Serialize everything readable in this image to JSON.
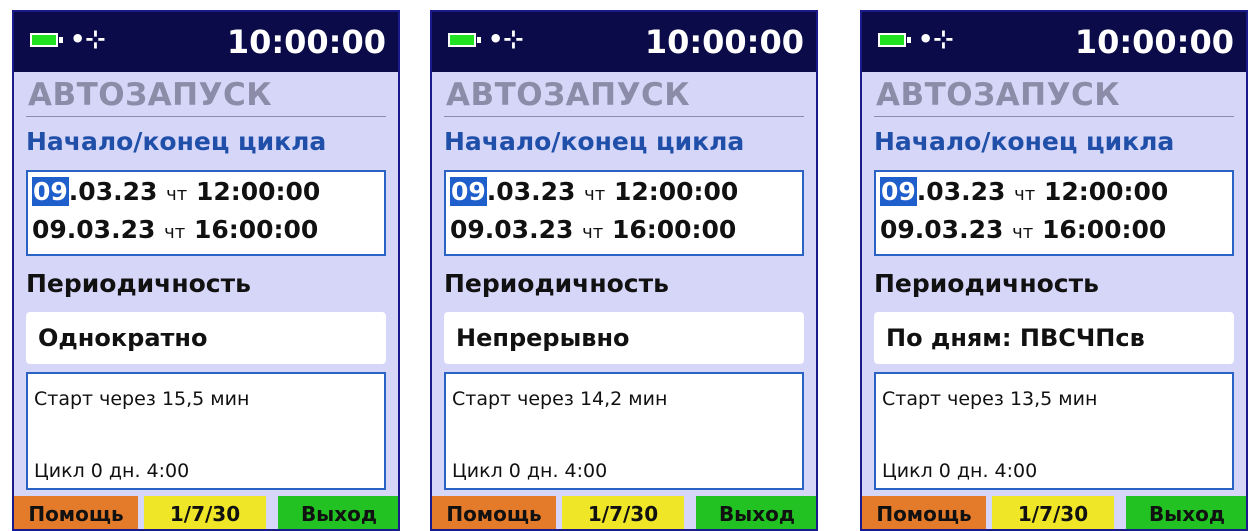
{
  "screens": [
    {
      "time": "10:00:00",
      "usb_glyph": "•⊹",
      "title": "АВТОЗАПУСК",
      "cycle_label": "Начало/конец цикла",
      "start": {
        "day": "09",
        "rest": ".03.23",
        "dow": "чт",
        "time": "12:00:00"
      },
      "end": {
        "date": "09.03.23",
        "dow": "чт",
        "time": "16:00:00"
      },
      "period_label": "Периодичность",
      "period_value": "Однократно",
      "start_in": "Старт через 15,5 мин",
      "cycle_len": "Цикл 0 дн. 4:00",
      "buttons": {
        "help": "Помощь",
        "mid": "1/7/30",
        "exit": "Выход"
      }
    },
    {
      "time": "10:00:00",
      "usb_glyph": "•⊹",
      "title": "АВТОЗАПУСК",
      "cycle_label": "Начало/конец цикла",
      "start": {
        "day": "09",
        "rest": ".03.23",
        "dow": "чт",
        "time": "12:00:00"
      },
      "end": {
        "date": "09.03.23",
        "dow": "чт",
        "time": "16:00:00"
      },
      "period_label": "Периодичность",
      "period_value": "Непрерывно",
      "start_in": "Старт через 14,2 мин",
      "cycle_len": "Цикл 0 дн. 4:00",
      "buttons": {
        "help": "Помощь",
        "mid": "1/7/30",
        "exit": "Выход"
      }
    },
    {
      "time": "10:00:00",
      "usb_glyph": "•⊹",
      "title": "АВТОЗАПУСК",
      "cycle_label": "Начало/конец цикла",
      "start": {
        "day": "09",
        "rest": ".03.23",
        "dow": "чт",
        "time": "12:00:00"
      },
      "end": {
        "date": "09.03.23",
        "dow": "чт",
        "time": "16:00:00"
      },
      "period_label": "Периодичность",
      "period_value": "По дням:  ПВСЧПсв",
      "start_in": "Старт через 13,5 мин",
      "cycle_len": "Цикл 0 дн. 4:00",
      "buttons": {
        "help": "Помощь",
        "mid": "1/7/30",
        "exit": "Выход"
      }
    }
  ],
  "icons": {
    "battery": "battery-icon",
    "usb": "usb-icon"
  },
  "colors": {
    "statusbar": "#0b0b4a",
    "screen_bg": "#d6d6f8",
    "accent": "#1f4fa8",
    "help": "#e37b2a",
    "mid": "#f0e628",
    "exit": "#22c222"
  }
}
